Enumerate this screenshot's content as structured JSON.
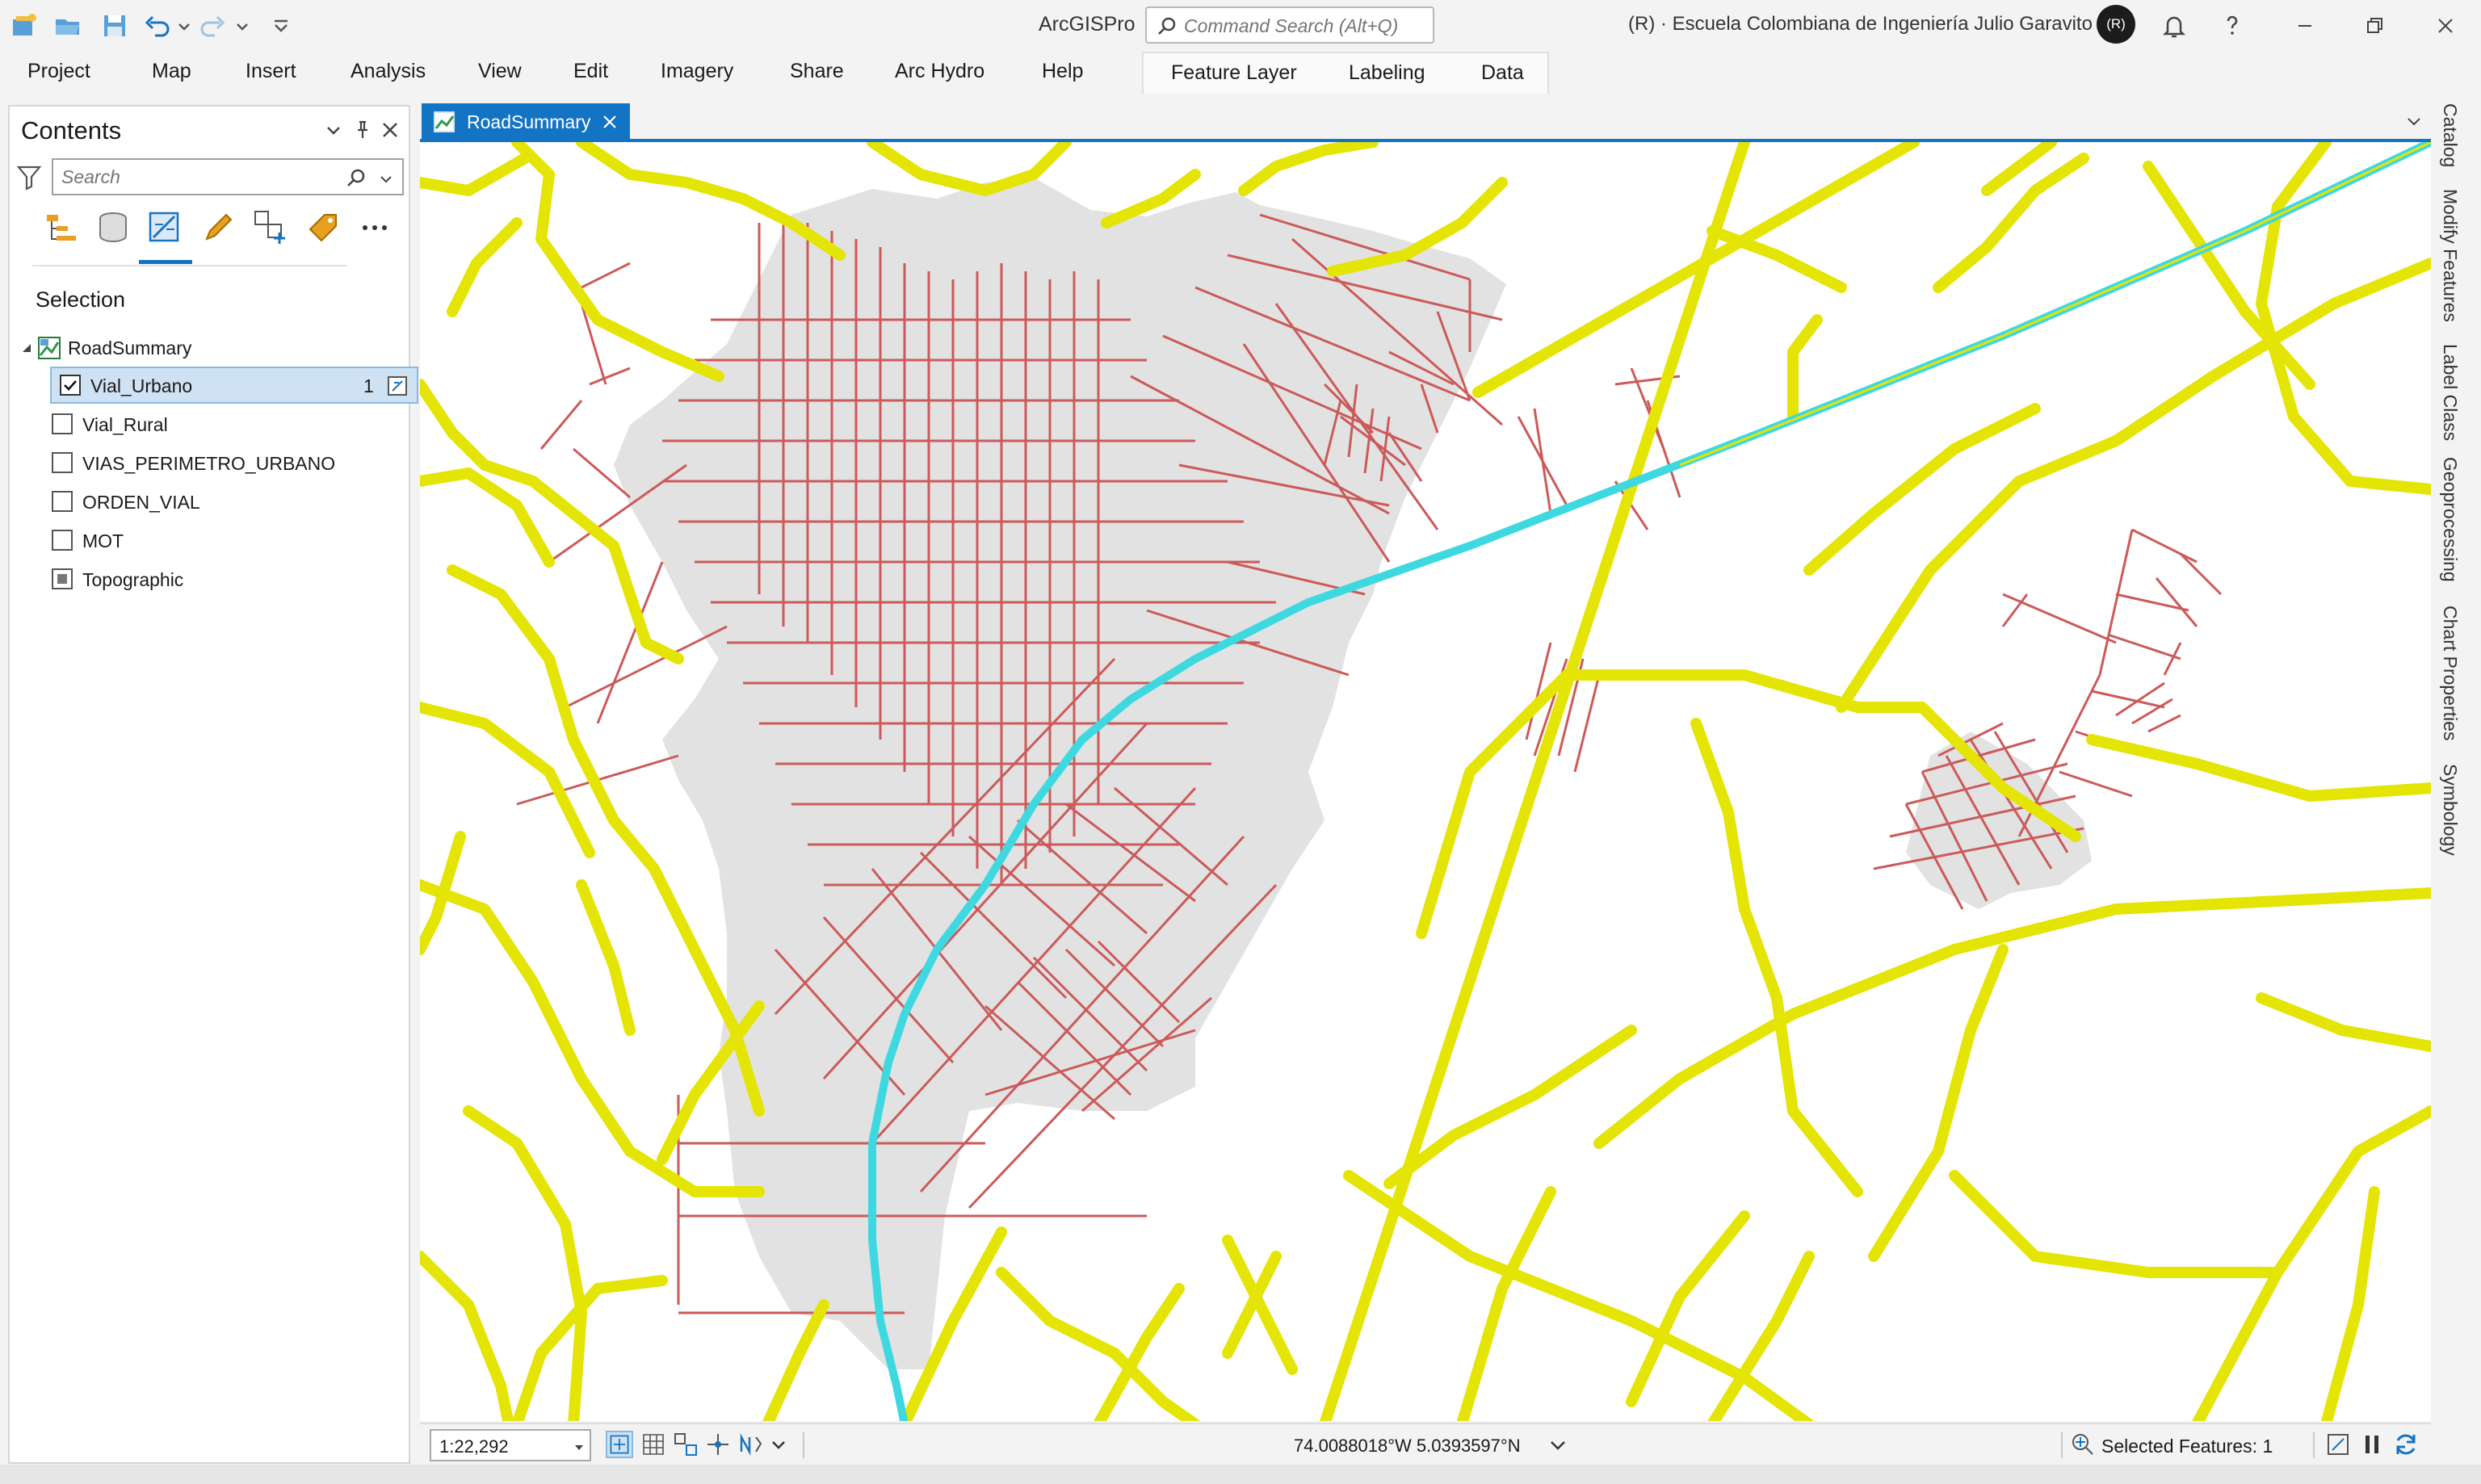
{
  "window": {
    "app_title": "ArcGISPro",
    "command_search_placeholder": "Command Search (Alt+Q)",
    "org_name": "(R) · Escuela Colombiana de Ingeniería Julio Garavito",
    "avatar_initials": "(R)"
  },
  "ribbon": {
    "tabs": [
      "Project",
      "Map",
      "Insert",
      "Analysis",
      "View",
      "Edit",
      "Imagery",
      "Share",
      "Arc Hydro",
      "Help"
    ],
    "contextual_tabs": [
      "Feature Layer",
      "Labeling",
      "Data"
    ]
  },
  "contents": {
    "title": "Contents",
    "search_placeholder": "Search",
    "section_label": "Selection",
    "map_name": "RoadSummary",
    "layers": [
      {
        "name": "Vial_Urbano",
        "checked": true,
        "selected": true,
        "count": "1"
      },
      {
        "name": "Vial_Rural",
        "checked": false
      },
      {
        "name": "VIAS_PERIMETRO_URBANO",
        "checked": false
      },
      {
        "name": "ORDEN_VIAL",
        "checked": false
      },
      {
        "name": "MOT",
        "checked": false
      },
      {
        "name": "Topographic",
        "checked": false,
        "basemap": true
      }
    ]
  },
  "map": {
    "tab_label": "RoadSummary",
    "colors": {
      "rural_roads": "#e4e405",
      "urban_roads": "#cc5a5a",
      "urban_area": "#e2e2e2",
      "selected_road": "#3ed8e0"
    }
  },
  "dock": [
    "Catalog",
    "Modify Features",
    "Label Class",
    "Geoprocessing",
    "Chart Properties",
    "Symbology"
  ],
  "status": {
    "scale": "1:22,292",
    "coordinates": "74.0088018°W 5.0393597°N",
    "selected_features": "Selected Features: 1"
  }
}
